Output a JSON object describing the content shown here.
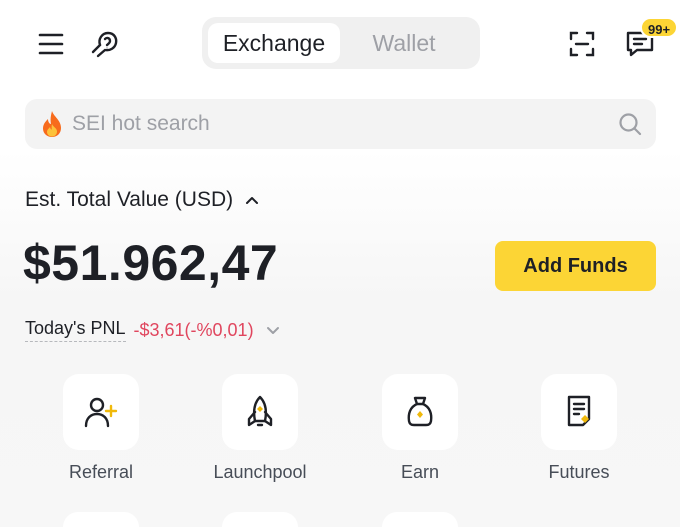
{
  "header": {
    "tabs": [
      {
        "label": "Exchange",
        "active": true
      },
      {
        "label": "Wallet",
        "active": false
      }
    ],
    "notification_badge": "99+",
    "icons": [
      "menu-icon",
      "customer-service-icon",
      "scan-icon",
      "message-icon"
    ]
  },
  "search": {
    "placeholder": "SEI hot search",
    "icons": [
      "fire-icon",
      "search-icon"
    ]
  },
  "balance": {
    "label": "Est. Total Value (USD)",
    "total": "$51.962,47",
    "add_funds_label": "Add Funds",
    "pnl_label": "Today's PNL",
    "pnl_value": "-$3,61(-%0,01)"
  },
  "shortcuts": [
    {
      "label": "Referral",
      "icon": "referral-icon"
    },
    {
      "label": "Launchpool",
      "icon": "launchpool-icon"
    },
    {
      "label": "Earn",
      "icon": "earn-icon"
    },
    {
      "label": "Futures",
      "icon": "futures-icon"
    }
  ],
  "colors": {
    "accent": "#fcd535",
    "negative": "#e0465e",
    "text": "#1e2026",
    "muted": "#9ea0a6"
  }
}
